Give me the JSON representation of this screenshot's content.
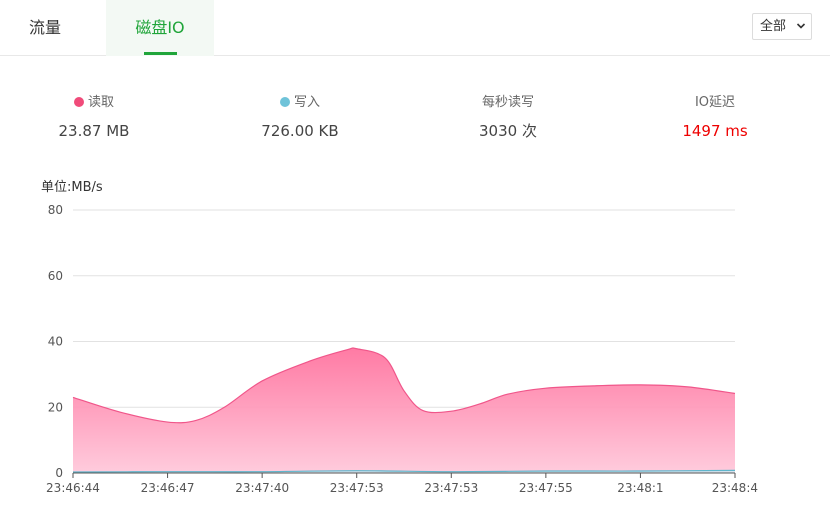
{
  "tabs": [
    {
      "label": "流量",
      "active": false
    },
    {
      "label": "磁盘IO",
      "active": true
    }
  ],
  "select": {
    "value": "全部"
  },
  "stats": {
    "read": {
      "label": "读取",
      "value": "23.87 MB",
      "dot_color": "#f04b7a"
    },
    "write": {
      "label": "写入",
      "value": "726.00 KB",
      "dot_color": "#6fc3d9"
    },
    "ops": {
      "label": "每秒读写",
      "value": "3030 次"
    },
    "latency": {
      "label": "IO延迟",
      "value": "1497 ms",
      "value_color": "#ee0000"
    }
  },
  "colors": {
    "accent": "#20a53a",
    "read_line": "#f0568a",
    "write_line": "#5fb6cc"
  },
  "chart_data": {
    "type": "area",
    "ylabel": "单位:MB/s",
    "ylim": [
      0,
      80
    ],
    "yticks": [
      0,
      20,
      40,
      60,
      80
    ],
    "xtick_labels": [
      "23:46:44",
      "23:46:47",
      "23:47:40",
      "23:47:53",
      "23:47:53",
      "23:47:55",
      "23:48:1",
      "23:48:4"
    ],
    "series": [
      {
        "name": "读取",
        "color": "#f0568a",
        "x": [
          0,
          0.5,
          1,
          1.3,
          1.6,
          2,
          2.5,
          2.9,
          3,
          3.3,
          3.5,
          3.7,
          4,
          4.3,
          4.6,
          5,
          5.5,
          6,
          6.5,
          7
        ],
        "values": [
          23,
          18.5,
          15.5,
          16,
          20,
          28,
          34,
          37.5,
          37.8,
          35,
          25,
          19,
          18.8,
          21,
          24,
          25.8,
          26.5,
          26.8,
          26.2,
          24.2
        ]
      },
      {
        "name": "写入",
        "color": "#5fb6cc",
        "x": [
          0,
          1,
          2,
          3,
          4,
          5,
          6,
          7
        ],
        "values": [
          0.3,
          0.4,
          0.4,
          0.7,
          0.4,
          0.6,
          0.6,
          0.8
        ]
      }
    ],
    "grid": true
  }
}
